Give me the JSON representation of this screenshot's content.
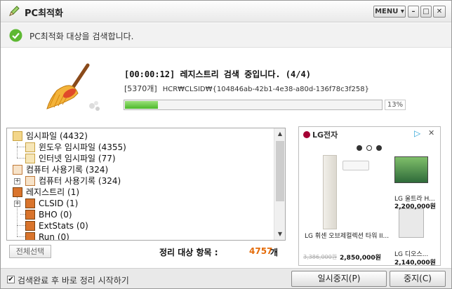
{
  "window": {
    "title": "PC최적화",
    "menu_label": "MENU ▾",
    "minimize_label": "–",
    "maximize_label": "□",
    "close_label": "✕"
  },
  "status": {
    "message": "PC최적화 대상을 검색합니다."
  },
  "scan": {
    "headline": "[00:00:12] 레지스트리 검색 중입니다. (4/4)",
    "item_count": "[5370개]",
    "current_path": "HCR₩CLSID₩{104846ab-42b1-4e38-a80d-136f78c3f258}",
    "progress_fraction": 0.13,
    "progress_label": "13%"
  },
  "tree": {
    "items": [
      {
        "label": "임시파일 (4432)",
        "icon": "folder-icon"
      },
      {
        "label": "윈도우 임시파일 (4355)",
        "icon": "temp-file-icon"
      },
      {
        "label": "인터넷 임시파일 (77)",
        "icon": "temp-file-icon"
      },
      {
        "label": "컴퓨터 사용기록 (324)",
        "icon": "history-icon"
      },
      {
        "label": "컴퓨터 사용기록 (324)",
        "icon": "history-icon"
      },
      {
        "label": "레지스트리 (1)",
        "icon": "registry-icon"
      },
      {
        "label": "CLSID (1)",
        "icon": "registry-icon"
      },
      {
        "label": "BHO (0)",
        "icon": "registry-icon"
      },
      {
        "label": "ExtStats (0)",
        "icon": "registry-icon"
      },
      {
        "label": "Run (0)",
        "icon": "registry-icon"
      }
    ]
  },
  "select_all_label": "전체선택",
  "summary": {
    "label": "정리 대상 항목 :",
    "count": "4757",
    "unit": "개"
  },
  "ad": {
    "brand": "LG전자",
    "choices_icon": "ad-choices-icon",
    "close_label": "✕",
    "products": [
      {
        "name": "LG 휘센 오브제컬렉션 타워 II...",
        "old_price": "3,386,000원",
        "price": "2,850,000원"
      },
      {
        "name": "LG 울트라 H...",
        "price": "2,200,000원"
      },
      {
        "name": "LG 디오스...",
        "price": "2,140,000원"
      }
    ]
  },
  "bottom": {
    "auto_clean_label": "검색완료 후 바로 정리 시작하기",
    "auto_clean_checked": true,
    "pause_label": "일시중지(P)",
    "stop_label": "중지(C)"
  },
  "colors": {
    "progress": "#4cb82a",
    "summary_count": "#e46c0a",
    "check_ok": "#5db832",
    "lg_brand": "#a50034"
  }
}
